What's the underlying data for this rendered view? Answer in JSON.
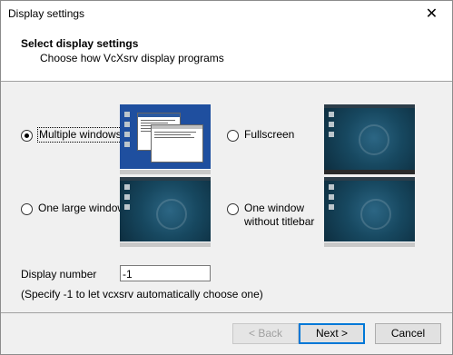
{
  "window": {
    "title": "Display settings",
    "close_glyph": "✕"
  },
  "header": {
    "title": "Select display settings",
    "subtitle": "Choose how VcXsrv display programs"
  },
  "options": [
    {
      "label": "Multiple windows",
      "checked": true
    },
    {
      "label": "Fullscreen",
      "checked": false
    },
    {
      "label": "One large window",
      "checked": false
    },
    {
      "label_line1": "One window",
      "label_line2": "without titlebar",
      "checked": false
    }
  ],
  "display_number": {
    "label": "Display number",
    "value": "-1"
  },
  "hint": "(Specify -1 to let vcxsrv automatically choose one)",
  "buttons": {
    "back": "< Back",
    "next": "Next >",
    "cancel": "Cancel"
  },
  "colors": {
    "accent": "#0078d7",
    "desktop": "#174860"
  }
}
